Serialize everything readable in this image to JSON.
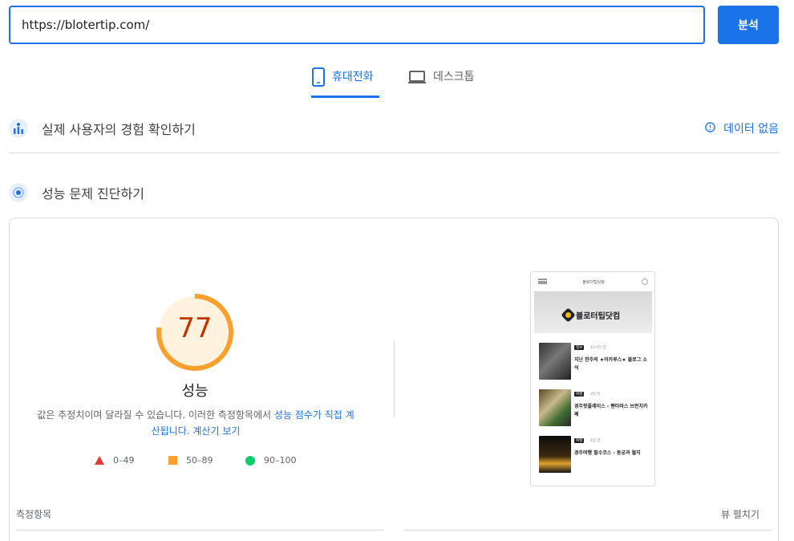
{
  "search": {
    "url": "https://blotertip.com/",
    "analyze_label": "분석"
  },
  "tabs": [
    {
      "label": "휴대전화",
      "icon": "phone-icon",
      "selected": true
    },
    {
      "label": "데스크톱",
      "icon": "laptop-icon",
      "selected": false
    }
  ],
  "field_data": {
    "title": "실제 사용자의 경험 확인하기",
    "status": "데이터 없음"
  },
  "diagnostics": {
    "title": "성능 문제 진단하기"
  },
  "performance": {
    "score": "77",
    "label": "성능",
    "note_plain": "값은 추정치이며 달라질 수 있습니다. 이러한 측정항목에서 ",
    "note_link1": "성능 점수가 직접 계산됩니다.",
    "note_link2": "계산기 보기",
    "gauge_fraction": 0.77
  },
  "legend": [
    {
      "range": "0–49",
      "shape": "triangle",
      "color": "#e53935"
    },
    {
      "range": "50–89",
      "shape": "square",
      "color": "#fba02c"
    },
    {
      "range": "90–100",
      "shape": "circle",
      "color": "#0cce6b"
    }
  ],
  "preview": {
    "site_title": "블로터팁닷컴",
    "logo_text": "블로터팁닷컴",
    "posts": [
      {
        "tag": "정보",
        "time": "11시간 전",
        "title": "지난 한주의 ★이카루스★ 블로그 소식"
      },
      {
        "tag": "여행",
        "time": "3일 전",
        "title": "경주핫플레이스 - 펜타마스 브런치카페"
      },
      {
        "tag": "여행",
        "time": "4일 전",
        "title": "경주여행 필수코스 - 동궁과 월지"
      }
    ]
  },
  "metrics": {
    "label": "측정항목",
    "expand": "뷰 펼치기"
  },
  "colors": {
    "accent": "#1a73e8",
    "score_text": "#c33300",
    "gauge": "#fba02c",
    "gauge_bg": "#fff3e0"
  }
}
